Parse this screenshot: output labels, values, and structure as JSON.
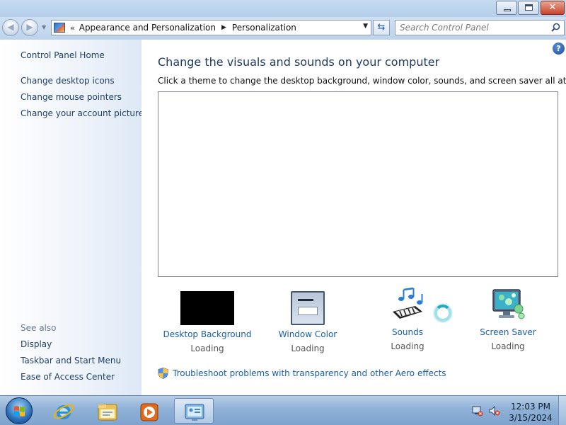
{
  "window": {
    "close_glyph": "✕"
  },
  "navbar": {
    "back_glyph": "◀",
    "forward_glyph": "▶",
    "address_prefix": "«",
    "breadcrumb": [
      "Appearance and Personalization",
      "Personalization"
    ],
    "search_placeholder": "Search Control Panel"
  },
  "left_pane": {
    "home_link": "Control Panel Home",
    "tasks": [
      "Change desktop icons",
      "Change mouse pointers",
      "Change your account picture"
    ],
    "see_also_label": "See also",
    "see_also": [
      "Display",
      "Taskbar and Start Menu",
      "Ease of Access Center"
    ]
  },
  "main": {
    "heading": "Change the visuals and sounds on your computer",
    "subtext": "Click a theme to change the desktop background, window color, sounds, and screen saver all at once.",
    "settings": [
      {
        "label": "Desktop Background",
        "status": "Loading",
        "icon": "desktop-background-icon"
      },
      {
        "label": "Window Color",
        "status": "Loading",
        "icon": "window-color-icon"
      },
      {
        "label": "Sounds",
        "status": "Loading",
        "icon": "sounds-icon"
      },
      {
        "label": "Screen Saver",
        "status": "Loading",
        "icon": "screen-saver-icon"
      }
    ],
    "troubleshoot_link": "Troubleshoot problems with transparency and other Aero effects",
    "help_glyph": "?"
  },
  "taskbar": {
    "time": "12:03 PM",
    "date": "3/15/2024",
    "pinned": [
      "internet-explorer-icon",
      "windows-explorer-icon",
      "media-player-icon",
      "control-panel-icon"
    ]
  },
  "colors": {
    "link": "#1a5fa8",
    "heading": "#1e3a64",
    "taskbar": "#8fb1d7"
  }
}
